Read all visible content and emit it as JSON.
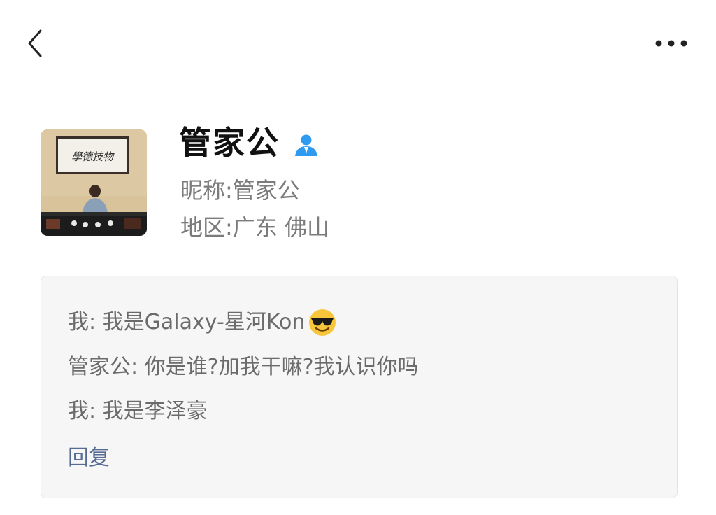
{
  "header": {
    "back_icon": "chevron-left-icon",
    "more_icon": "more-horizontal-icon"
  },
  "profile": {
    "avatar_icon": "profile-photo",
    "avatar_calligraphy": "學德技物",
    "name": "管家公",
    "verify_icon": "person-icon",
    "nickname": "昵称:管家公",
    "region": "地区:广东 佛山"
  },
  "messages": [
    {
      "text": "我: 我是Galaxy-星河Kon",
      "emoji": "smiling-face-with-sunglasses"
    },
    {
      "text": "管家公: 你是谁?加我干嘛?我认识你吗"
    },
    {
      "text": "我: 我是李泽豪"
    }
  ],
  "reply_label": "回复",
  "colors": {
    "accent_blue": "#2f9bf0",
    "reply_link": "#566b92",
    "muted_text": "#7b7b7b",
    "box_bg": "#f6f6f6"
  }
}
